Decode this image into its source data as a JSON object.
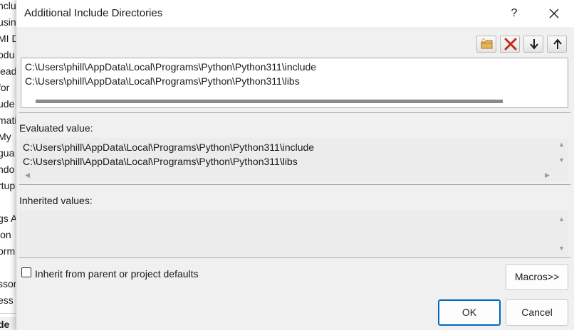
{
  "background_window": {
    "lines": [
      "nclu",
      "usin",
      "MI D",
      "odu",
      "lead",
      "for",
      "ude",
      "mati",
      "My",
      "gua",
      "ndo",
      "rtup",
      "l",
      "gs A",
      "ion",
      "orm",
      "",
      "ssor C",
      "ess S",
      "",
      "de"
    ]
  },
  "dialog": {
    "title": "Additional Include Directories",
    "help_label": "?",
    "toolbar": {
      "icons": [
        "new-folder-icon",
        "delete-icon",
        "move-down-icon",
        "move-up-icon"
      ]
    },
    "editor_lines": [
      "C:\\Users\\phill\\AppData\\Local\\Programs\\Python\\Python311\\include",
      "C:\\Users\\phill\\AppData\\Local\\Programs\\Python\\Python311\\libs"
    ],
    "evaluated_label": "Evaluated value:",
    "evaluated_lines": [
      "C:\\Users\\phill\\AppData\\Local\\Programs\\Python\\Python311\\include",
      "C:\\Users\\phill\\AppData\\Local\\Programs\\Python\\Python311\\libs"
    ],
    "inherited_label": "Inherited values:",
    "inherit_checkbox_label": "Inherit from parent or project defaults",
    "inherit_checked": false,
    "macros_button": "Macros>>",
    "ok_button": "OK",
    "cancel_button": "Cancel"
  },
  "colors": {
    "dialog_bg": "#f0f0f0",
    "default_button_border": "#0067c0",
    "delete_icon": "#c42b1c",
    "folder_icon": "#d9a441"
  }
}
